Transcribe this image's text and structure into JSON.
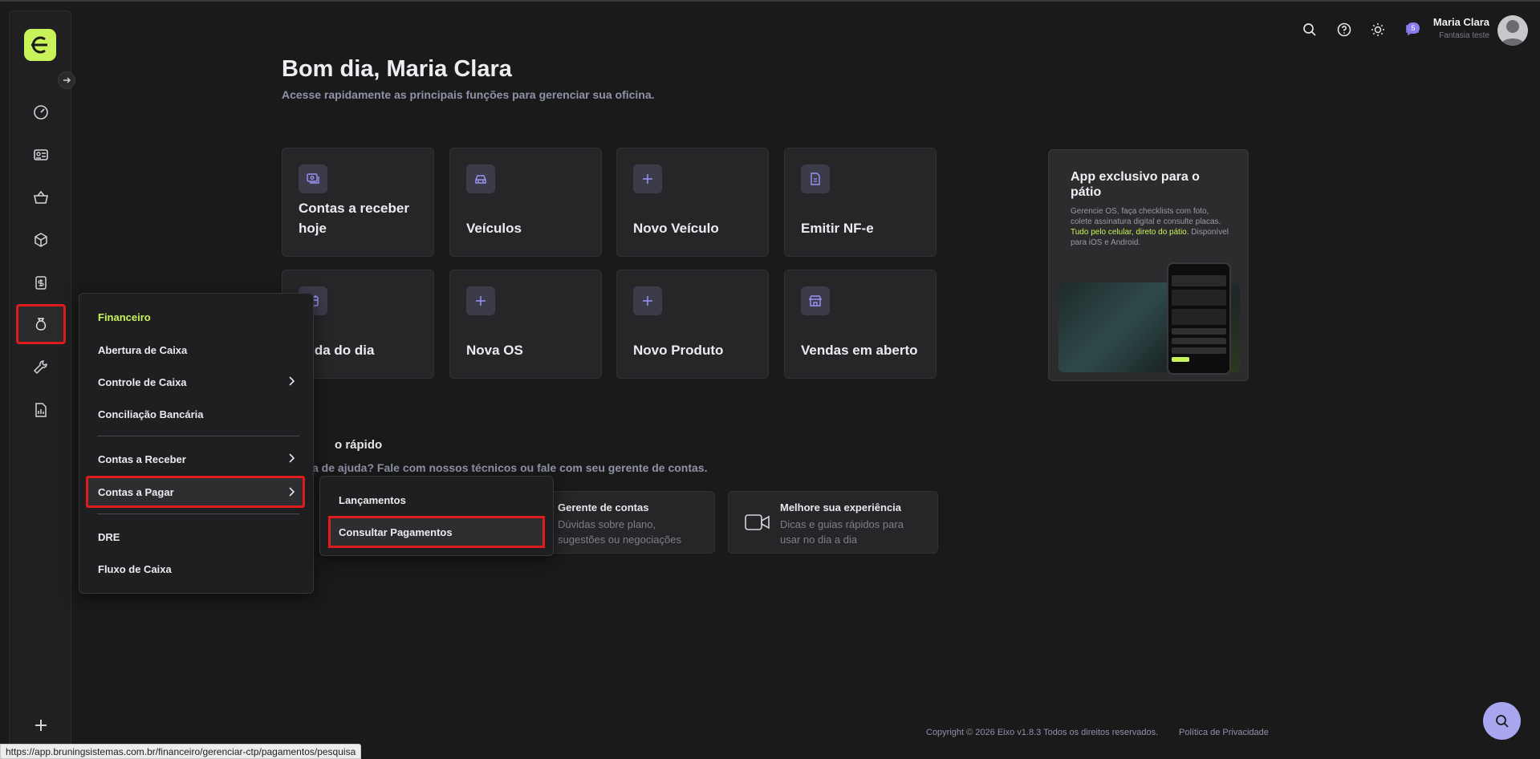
{
  "header": {
    "user_name": "Maria Clara",
    "user_company": "Fantasia teste",
    "notification_count": "5"
  },
  "greeting": {
    "title": "Bom dia, Maria Clara",
    "subtitle": "Acesse rapidamente as principais funções para gerenciar sua oficina."
  },
  "quick_cards": [
    {
      "label": "Contas a receber hoje",
      "icon": "receivable-icon"
    },
    {
      "label": "Veículos",
      "icon": "car-icon"
    },
    {
      "label": "Novo Veículo",
      "icon": "plus-icon"
    },
    {
      "label": "Emitir NF-e",
      "icon": "document-icon"
    },
    {
      "label": "enda do dia",
      "icon": "calendar-icon"
    },
    {
      "label": "Nova OS",
      "icon": "plus-icon"
    },
    {
      "label": "Novo Produto",
      "icon": "plus-icon"
    },
    {
      "label": "Vendas em aberto",
      "icon": "store-icon"
    }
  ],
  "promo": {
    "title": "App exclusivo para o pátio",
    "text_before": "Gerencie OS, faça checklists com foto, colete assinatura digital e consulte placas. ",
    "text_highlight": "Tudo pelo celular, direto do pátio.",
    "text_after": " Disponível para iOS e Android."
  },
  "help": {
    "title": "o rápido",
    "subtitle": "a de ajuda? Fale com nossos técnicos ou fale com seu gerente de contas.",
    "cards": [
      {
        "title": "Gerente de contas",
        "desc": "Dúvidas sobre plano, sugestões ou negociações"
      },
      {
        "title": "Melhore sua experiência",
        "desc": "Dicas e guias rápidos para usar no dia a dia"
      }
    ]
  },
  "menu": {
    "heading": "Financeiro",
    "items": [
      {
        "label": "Abertura de Caixa"
      },
      {
        "label": "Controle de Caixa"
      },
      {
        "label": "Conciliação Bancária"
      },
      {
        "label": "Contas a Receber"
      },
      {
        "label": "Contas a Pagar"
      },
      {
        "label": "DRE"
      },
      {
        "label": "Fluxo de Caixa"
      }
    ]
  },
  "submenu": {
    "items": [
      {
        "label": "Lançamentos"
      },
      {
        "label": "Consultar Pagamentos"
      }
    ]
  },
  "footer": {
    "copyright": "Copyright © 2026 Eixo v1.8.3 Todos os direitos reservados.",
    "privacy": "Política de Privacidade"
  },
  "status_url": "https://app.bruningsistemas.com.br/financeiro/gerenciar-ctp/pagamentos/pesquisa",
  "colors": {
    "accent_lime": "#c9f35b",
    "accent_purple": "#a9a6f0",
    "highlight_red": "#e01b1b"
  }
}
